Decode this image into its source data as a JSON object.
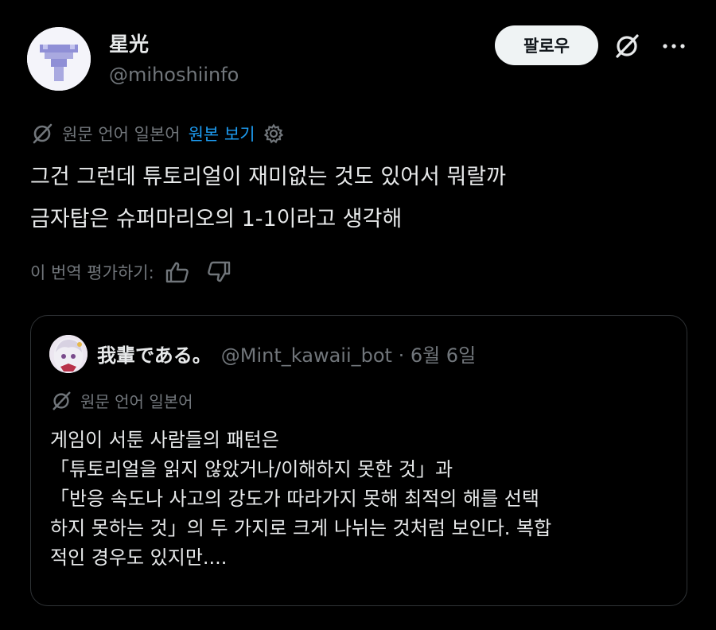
{
  "author": {
    "display_name": "星光",
    "handle": "@mihoshiinfo"
  },
  "actions": {
    "follow_label": "팔로우"
  },
  "translation": {
    "source_language": "원문 언어 일본어",
    "show_original": "원본 보기"
  },
  "tweet": {
    "lines": [
      "그건 그런데 튜토리얼이 재미없는 것도 있어서 뭐랄까",
      "금자탑은 슈퍼마리오의 1-1이라고 생각해"
    ]
  },
  "rating": {
    "label": "이 번역 평가하기:"
  },
  "quote": {
    "display_name": "我輩である。",
    "meta": "@Mint_kawaii_bot · 6월 6일",
    "source_language": "원문 언어 일본어",
    "lines": [
      "게임이 서툰 사람들의 패턴은",
      "「튜토리얼을 읽지 않았거나/이해하지 못한 것」과",
      "「반응 속도나 사고의 강도가 따라가지 못해 최적의 해를 선택",
      "하지 못하는 것」의 두 가지로 크게 나뉘는 것처럼 보인다. 복합",
      "적인 경우도 있지만...."
    ]
  },
  "colors": {
    "background": "#000000",
    "text_primary": "#e7e9ea",
    "text_secondary": "#71767b",
    "accent_link": "#1d9bf0",
    "button_bg": "#eff3f4",
    "border": "#2f3336"
  },
  "icons": {
    "grok": "slashed-circle-icon",
    "more": "ellipsis-icon",
    "translate": "slashed-circle-icon",
    "settings": "gear-icon",
    "thumbs_up": "thumbs-up-icon",
    "thumbs_down": "thumbs-down-icon"
  }
}
